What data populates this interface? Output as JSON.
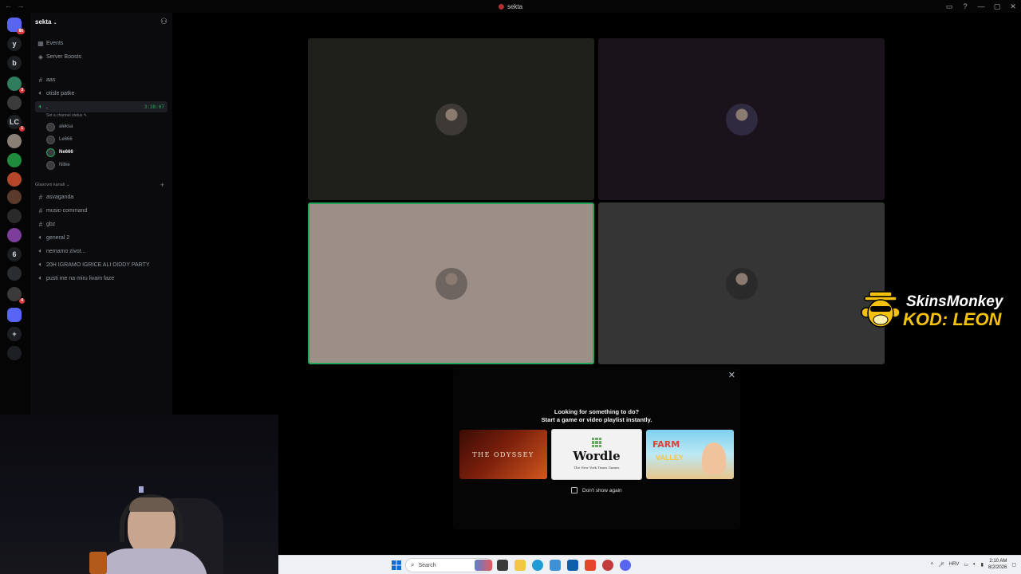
{
  "window": {
    "title": "sekta",
    "controls": [
      "inbox-icon",
      "help-icon",
      "minimize-icon",
      "maximize-icon",
      "close-icon"
    ]
  },
  "rail": {
    "items": [
      {
        "label": "",
        "icon": "discord-home-icon",
        "badge": "86"
      },
      {
        "label": "y",
        "badge": ""
      },
      {
        "label": "b",
        "badge": ""
      },
      {
        "label": "",
        "badge": "3"
      },
      {
        "label": "",
        "badge": ""
      },
      {
        "label": "LC",
        "badge": "1"
      },
      {
        "label": "",
        "badge": ""
      },
      {
        "label": "",
        "badge": ""
      },
      {
        "label": "",
        "badge": ""
      },
      {
        "label": "",
        "badge": ""
      },
      {
        "label": "",
        "badge": ""
      },
      {
        "label": "",
        "badge": ""
      },
      {
        "label": "6",
        "badge": ""
      },
      {
        "label": "",
        "badge": ""
      },
      {
        "label": "",
        "badge": "4"
      },
      {
        "label": "",
        "badge": ""
      },
      {
        "label": "+",
        "badge": ""
      },
      {
        "label": "",
        "badge": ""
      }
    ]
  },
  "sidebar": {
    "server_name": "sekta",
    "top_items": [
      {
        "label": "Events",
        "icon": "calendar-icon"
      },
      {
        "label": "Server Boosts",
        "icon": "boost-icon"
      }
    ],
    "channels": [
      {
        "label": "aas",
        "type": "text"
      },
      {
        "label": "otisle patke",
        "type": "voice"
      },
      {
        "label": ".",
        "type": "voice",
        "active": true,
        "timer": "3:38:07"
      }
    ],
    "channel_status": "Set a channel status",
    "voice_users": [
      {
        "name": "aleksa",
        "speaking": false
      },
      {
        "name": "Le666",
        "speaking": false
      },
      {
        "name": "Ne666",
        "speaking": true
      },
      {
        "name": "Nitke",
        "speaking": false
      }
    ],
    "category": "Glasovni kanali",
    "category_channels": [
      {
        "label": "asvaganda",
        "type": "text"
      },
      {
        "label": "music-command",
        "type": "text"
      },
      {
        "label": "gbz",
        "type": "text"
      },
      {
        "label": "general 2",
        "type": "voice"
      },
      {
        "label": "nemamo zivot...",
        "type": "voice"
      },
      {
        "label": "20H IGRAMO IGRICE ALI DIDDY PARTY",
        "type": "voice"
      },
      {
        "label": "pusti me na miru livam faze",
        "type": "voice"
      }
    ]
  },
  "video_tiles": [
    {
      "bg": "#1f1f1c",
      "avatar_color": "#3d3a36",
      "speaking": false
    },
    {
      "bg": "#1b131c",
      "avatar_color": "#2f2a3f",
      "speaking": false
    },
    {
      "bg": "#9c8f87",
      "avatar_color": "#6e6560",
      "speaking": true
    },
    {
      "bg": "#353535",
      "avatar_color": "#2a2a2a",
      "speaking": false
    }
  ],
  "activity_popup": {
    "line1": "Looking for something to do?",
    "line2": "Start a game or video playlist instantly.",
    "cards": [
      {
        "title": "THE ODYSSEY"
      },
      {
        "title": "Wordle",
        "subtitle": "The New York Times Games"
      },
      {
        "title": "FARM",
        "subtitle": "VALLEY"
      }
    ],
    "checkbox_label": "Don't show again"
  },
  "sponsor": {
    "line1": "SkinsMonkey",
    "line2": "KOD: LEON"
  },
  "taskbar": {
    "search_placeholder": "Search",
    "language": "HRV",
    "time": "2:10 AM",
    "date": "8/2/2026"
  },
  "colors": {
    "accent_green": "#23a55a",
    "badge_red": "#da373c",
    "sponsor_yellow": "#f4c20d"
  }
}
